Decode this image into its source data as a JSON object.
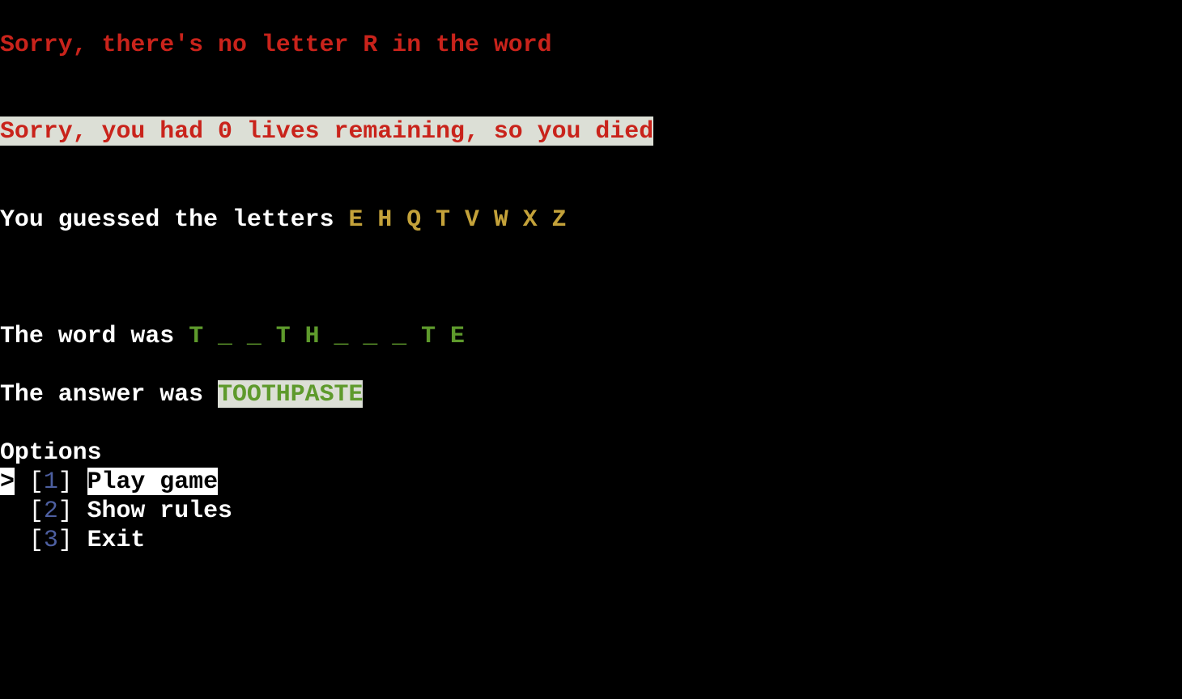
{
  "messages": {
    "no_letter": "Sorry, there's no letter R in the word",
    "died": "Sorry, you had 0 lives remaining, so you died"
  },
  "guessed": {
    "prefix": "You guessed the letters ",
    "letters": "E H Q T V W X Z"
  },
  "word": {
    "prefix": "The word was ",
    "pattern": "T _ _ T H _ _ _ T E"
  },
  "answer": {
    "prefix": "The answer was ",
    "value": "TOOTHPASTE"
  },
  "options": {
    "heading": "Options",
    "cursor": ">",
    "items": [
      {
        "number": "1",
        "label": "Play game"
      },
      {
        "number": "2",
        "label": "Show rules"
      },
      {
        "number": "3",
        "label": "Exit"
      }
    ]
  },
  "colors": {
    "error_red": "#c9231b",
    "letter_yellow": "#c4a23a",
    "word_green": "#5e9a2c",
    "number_blue": "#4d5fa0"
  }
}
